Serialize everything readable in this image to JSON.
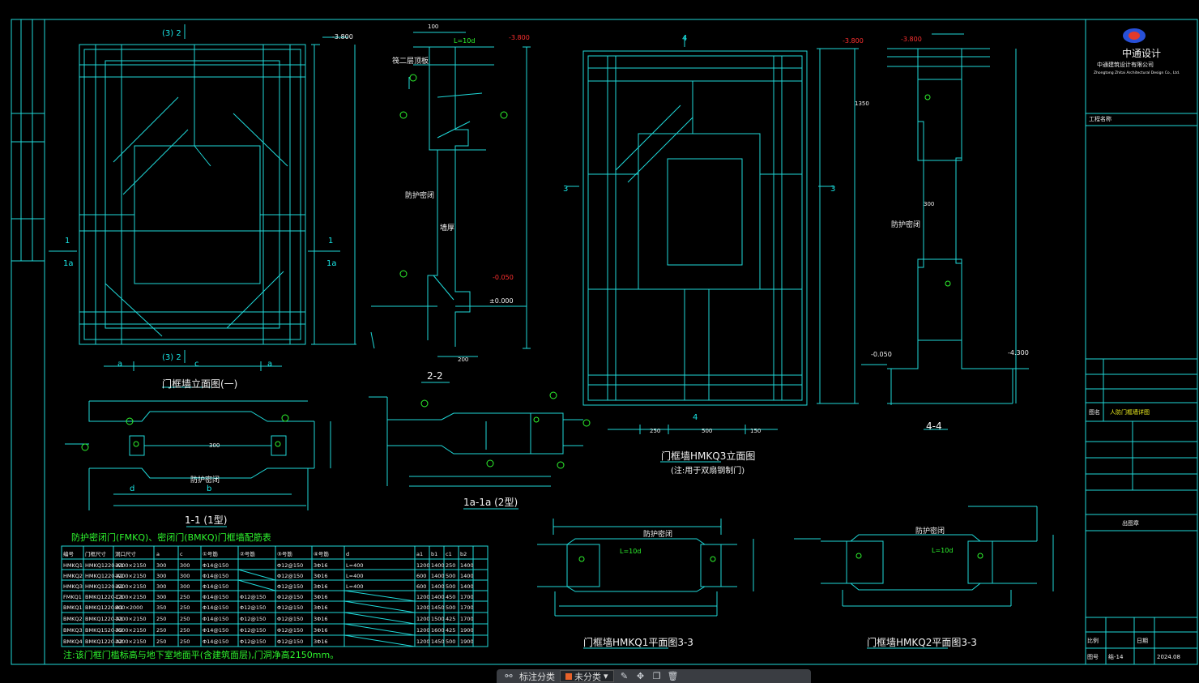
{
  "frame": {
    "line_color": "#1fd9d9",
    "bg": "#000000"
  },
  "titles": {
    "elev1": "门框墙立面图(一)",
    "sec22": "2-2",
    "elev3": "门框墙HMKQ3立面图",
    "elev3_note": "(注:用于双扇钢制门)",
    "sec44": "4-4",
    "sec11": "1-1  (1型)",
    "sec1a": "1a-1a  (2型)",
    "plan1": "门框墙HMKQ1平面图3-3",
    "plan2": "门框墙HMKQ2平面图3-3"
  },
  "marks": {
    "a": "a",
    "b": "b",
    "c": "c",
    "d": "d",
    "m1": "1",
    "m1a": "1a",
    "m3": "3",
    "m4": "4",
    "m32": "(3) 2",
    "lv1": "-3.800",
    "lv2": "-3.800",
    "lv3": "-3.800",
    "lv4": "-3.800",
    "lv5": "-0.050",
    "lv6": "±0.000",
    "lv7": "-0.050",
    "lv8": "-4.300",
    "lw": "L=10d",
    "fl2": "筏二层顶板",
    "b1": "防护密闭",
    "b2": "墙厚"
  },
  "dims": {
    "d100": "100",
    "d200": "200",
    "d300": "300",
    "d500": "500",
    "d250": "250",
    "d150": "150",
    "d1350": "1350",
    "d300b": "300"
  },
  "table": {
    "title": "防护密闭门(FMKQ)、密闭门(BMKQ)门框墙配筋表",
    "headers": [
      "编号",
      "门框尺寸",
      "洞口尺寸",
      "a",
      "c",
      "①号筋",
      "②号筋",
      "③号筋",
      "④号筋",
      "d",
      "a1",
      "b1",
      "c1",
      "b2"
    ],
    "rows": [
      [
        "HMKQ1",
        "HMKQ1220-A1",
        "1200×2150",
        "300",
        "300",
        "Φ14@150",
        "",
        "Φ12@150",
        "3Φ16",
        "L=400",
        "1200",
        "1400",
        "250",
        "1400"
      ],
      [
        "HMKQ2",
        "HMKQ1220-A2",
        "1200×2150",
        "300",
        "300",
        "Φ14@150",
        "",
        "Φ12@150",
        "3Φ16",
        "L=400",
        "600",
        "1400",
        "500",
        "1400"
      ],
      [
        "HMKQ3",
        "HMKQ1220-A2",
        "1200×2150",
        "300",
        "300",
        "Φ14@150",
        "",
        "Φ12@150",
        "3Φ16",
        "L=400",
        "600",
        "1400",
        "500",
        "1400"
      ],
      [
        "FMKQ1",
        "BMKQ1220-C1",
        "1200×2150",
        "300",
        "250",
        "Φ14@150",
        "Φ12@150",
        "Φ12@150",
        "3Φ16",
        "",
        "1200",
        "1400",
        "450",
        "1700"
      ],
      [
        "BMKQ1",
        "BMKQ1220-A1",
        "800×2000",
        "350",
        "250",
        "Φ14@150",
        "Φ12@150",
        "Φ12@150",
        "3Φ16",
        "",
        "1200",
        "1450",
        "500",
        "1700"
      ],
      [
        "BMKQ2",
        "BMKQ1220-A1",
        "1200×2150",
        "250",
        "250",
        "Φ14@150",
        "Φ12@150",
        "Φ12@150",
        "3Φ16",
        "",
        "1200",
        "1500",
        "425",
        "1700"
      ],
      [
        "BMKQ3",
        "BMKQ1520-A2",
        "1500×2150",
        "250",
        "250",
        "Φ14@150",
        "Φ12@150",
        "Φ12@150",
        "3Φ16",
        "",
        "1200",
        "1600",
        "425",
        "1900"
      ],
      [
        "BMKQ4",
        "BMKQ1220-A2",
        "1200×2150",
        "250",
        "250",
        "Φ14@150",
        "Φ12@150",
        "Φ12@150",
        "3Φ16",
        "",
        "1200",
        "1450",
        "500",
        "1900"
      ]
    ],
    "note": "注:该门框门槛标高与地下室地面平(含建筑面层),门洞净高2150mm。"
  },
  "title_block": {
    "company_cn": "中通设计",
    "company_sub": "中通建筑设计有限公司",
    "company_en": "Zhongtong Zhitai Architectural Design Co., Ltd.",
    "project_label": "工程名称",
    "drawing_label": "图名",
    "drawing_name": "人防门框墙详图",
    "stamp_label": "出图章",
    "scale_label": "比例",
    "date_label": "日期",
    "no_label": "图号",
    "no_value": "结-14",
    "date_value": "2024.08"
  },
  "toolbar": {
    "annotation_label": "标注分类",
    "category_value": "未分类",
    "colors": {
      "swatch": "#e8622a",
      "bar": "#3a3d42"
    }
  }
}
